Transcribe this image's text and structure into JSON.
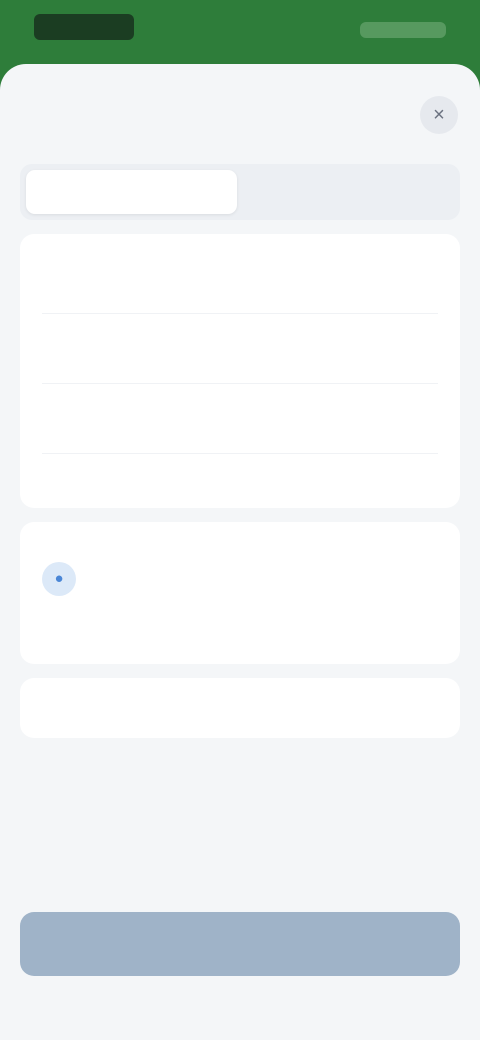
{
  "status_bar": {
    "left_text": "",
    "right_text": ""
  },
  "sheet": {
    "title": "",
    "close_glyph": "×"
  },
  "tabs": [
    {
      "label": "",
      "active": true
    },
    {
      "label": "",
      "active": false
    }
  ],
  "details": {
    "rows": [
      {
        "label": "",
        "value": ""
      },
      {
        "label": "",
        "value": ""
      },
      {
        "label": "",
        "value": ""
      }
    ],
    "description_title": "",
    "description_text": ""
  },
  "contacts_section": {
    "title": "",
    "contact_name": "",
    "contact_sub": "",
    "view_all": ""
  },
  "footer_row": {
    "label": "",
    "value": ""
  },
  "primary_button": {
    "label": ""
  },
  "colors": {
    "brand_green": "#2e7d3a",
    "link_blue": "#4a86d6",
    "button_disabled": "#9fb3c8",
    "sheet_bg": "#f4f6f8"
  },
  "icons": {
    "close": "close-icon",
    "contact": "person-icon"
  }
}
